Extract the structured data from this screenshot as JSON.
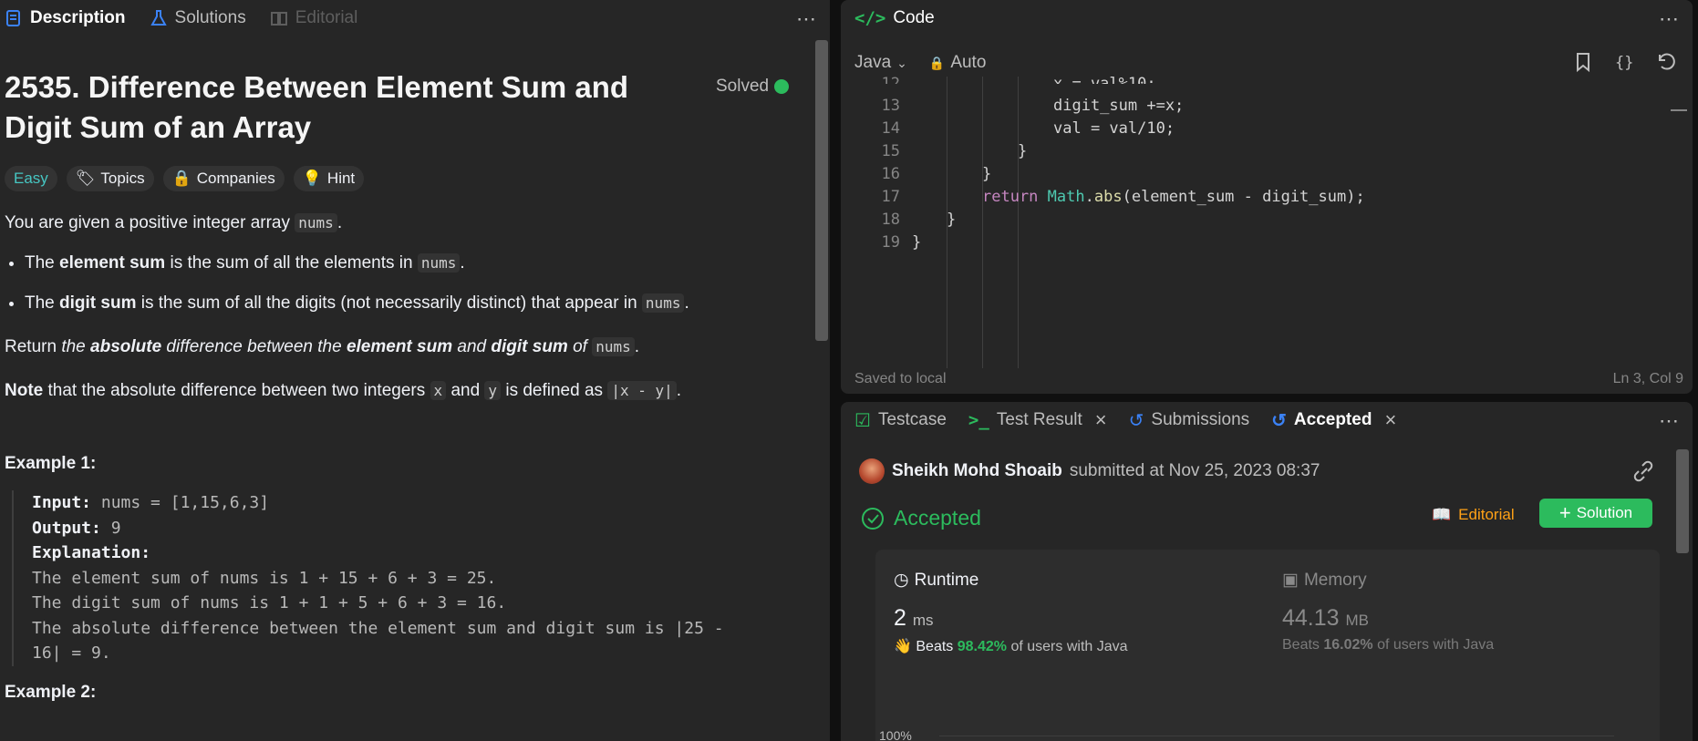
{
  "left_tabs": {
    "description": "Description",
    "solutions": "Solutions",
    "editorial": "Editorial"
  },
  "problem": {
    "title": "2535. Difference Between Element Sum and Digit Sum of an Array",
    "status": "Solved",
    "difficulty": "Easy",
    "topics": "Topics",
    "companies": "Companies",
    "hint": "Hint",
    "intro_text": "You are given a positive integer array",
    "intro_code": "nums",
    "bullet1_pre": "The",
    "bullet1_bold": "element sum",
    "bullet1_post": "is the sum of all the elements in",
    "bullet1_code": "nums",
    "bullet2_pre": "The",
    "bullet2_bold": "digit sum",
    "bullet2_post": "is the sum of all the digits (not necessarily distinct) that appear in",
    "bullet2_code": "nums",
    "return_pre": "Return",
    "return_i1": "the",
    "return_b1": "absolute",
    "return_i2": "difference between the",
    "return_b2": "element sum",
    "return_i3": "and",
    "return_b3": "digit sum",
    "return_i4": "of",
    "return_code": "nums",
    "note_bold": "Note",
    "note_text": "that the absolute difference between two integers",
    "note_x": "x",
    "note_and": "and",
    "note_y": "y",
    "note_defined": "is defined as",
    "note_expr": "|x - y|",
    "example_title": "Example 1:",
    "input_label": "Input:",
    "input_value": "nums = [1,15,6,3]",
    "output_label": "Output:",
    "output_value": "9",
    "explanation_label": "Explanation:",
    "exp_line1": "The element sum of nums is 1 + 15 + 6 + 3 = 25.",
    "exp_line2": "The digit sum of nums is 1 + 1 + 5 + 6 + 3 = 16.",
    "exp_line3": "The absolute difference between the element sum and digit sum is |25 -",
    "exp_line4": "16| = 9.",
    "next_example": "Example 2:"
  },
  "code_panel": {
    "title": "Code",
    "language": "Java",
    "mode": "Auto",
    "status_left": "Saved to local",
    "status_right": "Ln 3, Col 9",
    "lines": [
      {
        "n": "12",
        "text": "x = val%10;"
      },
      {
        "n": "13",
        "text": "digit_sum +=x;"
      },
      {
        "n": "14",
        "text": "val = val/10;"
      },
      {
        "n": "15",
        "text": "}"
      },
      {
        "n": "16",
        "text": "}"
      },
      {
        "n": "17",
        "text": "return Math.abs(element_sum - digit_sum);"
      },
      {
        "n": "18",
        "text": "}"
      },
      {
        "n": "19",
        "text": "}"
      }
    ]
  },
  "result_panel": {
    "tabs": {
      "testcase": "Testcase",
      "test_result": "Test Result",
      "submissions": "Submissions",
      "accepted": "Accepted"
    },
    "user": "Sheikh Mohd Shoaib",
    "submitted_text": "submitted at Nov 25, 2023 08:37",
    "verdict": "Accepted",
    "editorial_btn": "Editorial",
    "solution_btn": "Solution",
    "runtime": {
      "label": "Runtime",
      "value": "2",
      "unit": "ms",
      "beats_label": "Beats",
      "beats_pct": "98.42%",
      "beats_suffix": "of users with Java"
    },
    "memory": {
      "label": "Memory",
      "value": "44.13",
      "unit": "MB",
      "beats_label": "Beats",
      "beats_pct": "16.02%",
      "beats_suffix": "of users with Java"
    },
    "chart_axis_label": "100%"
  },
  "colors": {
    "easy": "#46c6c2",
    "accepted": "#2cbb5d",
    "editorial": "#ffa116",
    "keyword": "#c586c0",
    "class": "#4ec9b0"
  }
}
